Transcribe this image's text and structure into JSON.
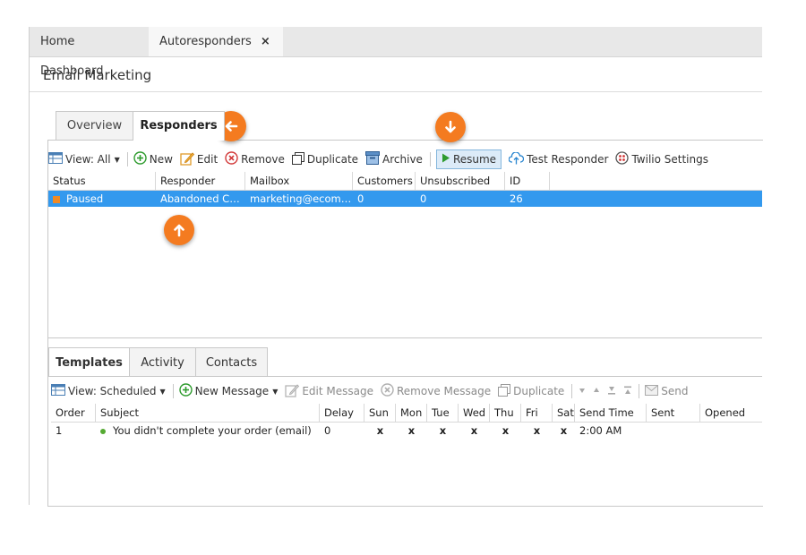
{
  "top_tabs": [
    {
      "label": "Home Dashboard"
    },
    {
      "label": "Autoresponders"
    }
  ],
  "close_glyph": "×",
  "app_title": "Email Marketing",
  "upper_tabs": [
    {
      "label": "Overview"
    },
    {
      "label": "Responders"
    }
  ],
  "responder_toolbar": {
    "view": "View: All",
    "new": "New",
    "edit": "Edit",
    "remove": "Remove",
    "duplicate": "Duplicate",
    "archive": "Archive",
    "resume": "Resume",
    "test": "Test Responder",
    "twilio": "Twilio Settings"
  },
  "responders_table": {
    "headers": [
      "Status",
      "Responder",
      "Mailbox",
      "Customers",
      "Unsubscribed",
      "ID"
    ],
    "rows": [
      [
        "Paused",
        "Abandoned Cart...",
        "marketing@ecomme...",
        "0",
        "0",
        "26"
      ]
    ]
  },
  "bottom_tabs": [
    {
      "label": "Templates"
    },
    {
      "label": "Activity"
    },
    {
      "label": "Contacts"
    }
  ],
  "template_toolbar": {
    "view": "View: Scheduled",
    "new_message": "New Message",
    "edit_message": "Edit Message",
    "remove_message": "Remove Message",
    "duplicate": "Duplicate",
    "send": "Send"
  },
  "templates_table": {
    "headers": [
      "Order",
      "Subject",
      "Delay",
      "Sun",
      "Mon",
      "Tue",
      "Wed",
      "Thu",
      "Fri",
      "Sat",
      "Send Time",
      "Sent",
      "Opened"
    ],
    "rows": [
      [
        "1",
        "You didn't complete your order (email)",
        "0",
        "x",
        "x",
        "x",
        "x",
        "x",
        "x",
        "x",
        "2:00 AM",
        "",
        ""
      ]
    ]
  },
  "colors": {
    "callout": "#f47b20",
    "selection": "#3399ee",
    "status_dot": "#55aa33"
  },
  "icons": [
    "table-view-icon",
    "add-icon",
    "edit-icon",
    "remove-icon",
    "duplicate-icon",
    "archive-icon",
    "play-icon",
    "cloud-upload-icon",
    "twilio-icon",
    "arrow-left-icon",
    "arrow-down-icon",
    "arrow-up-icon"
  ]
}
